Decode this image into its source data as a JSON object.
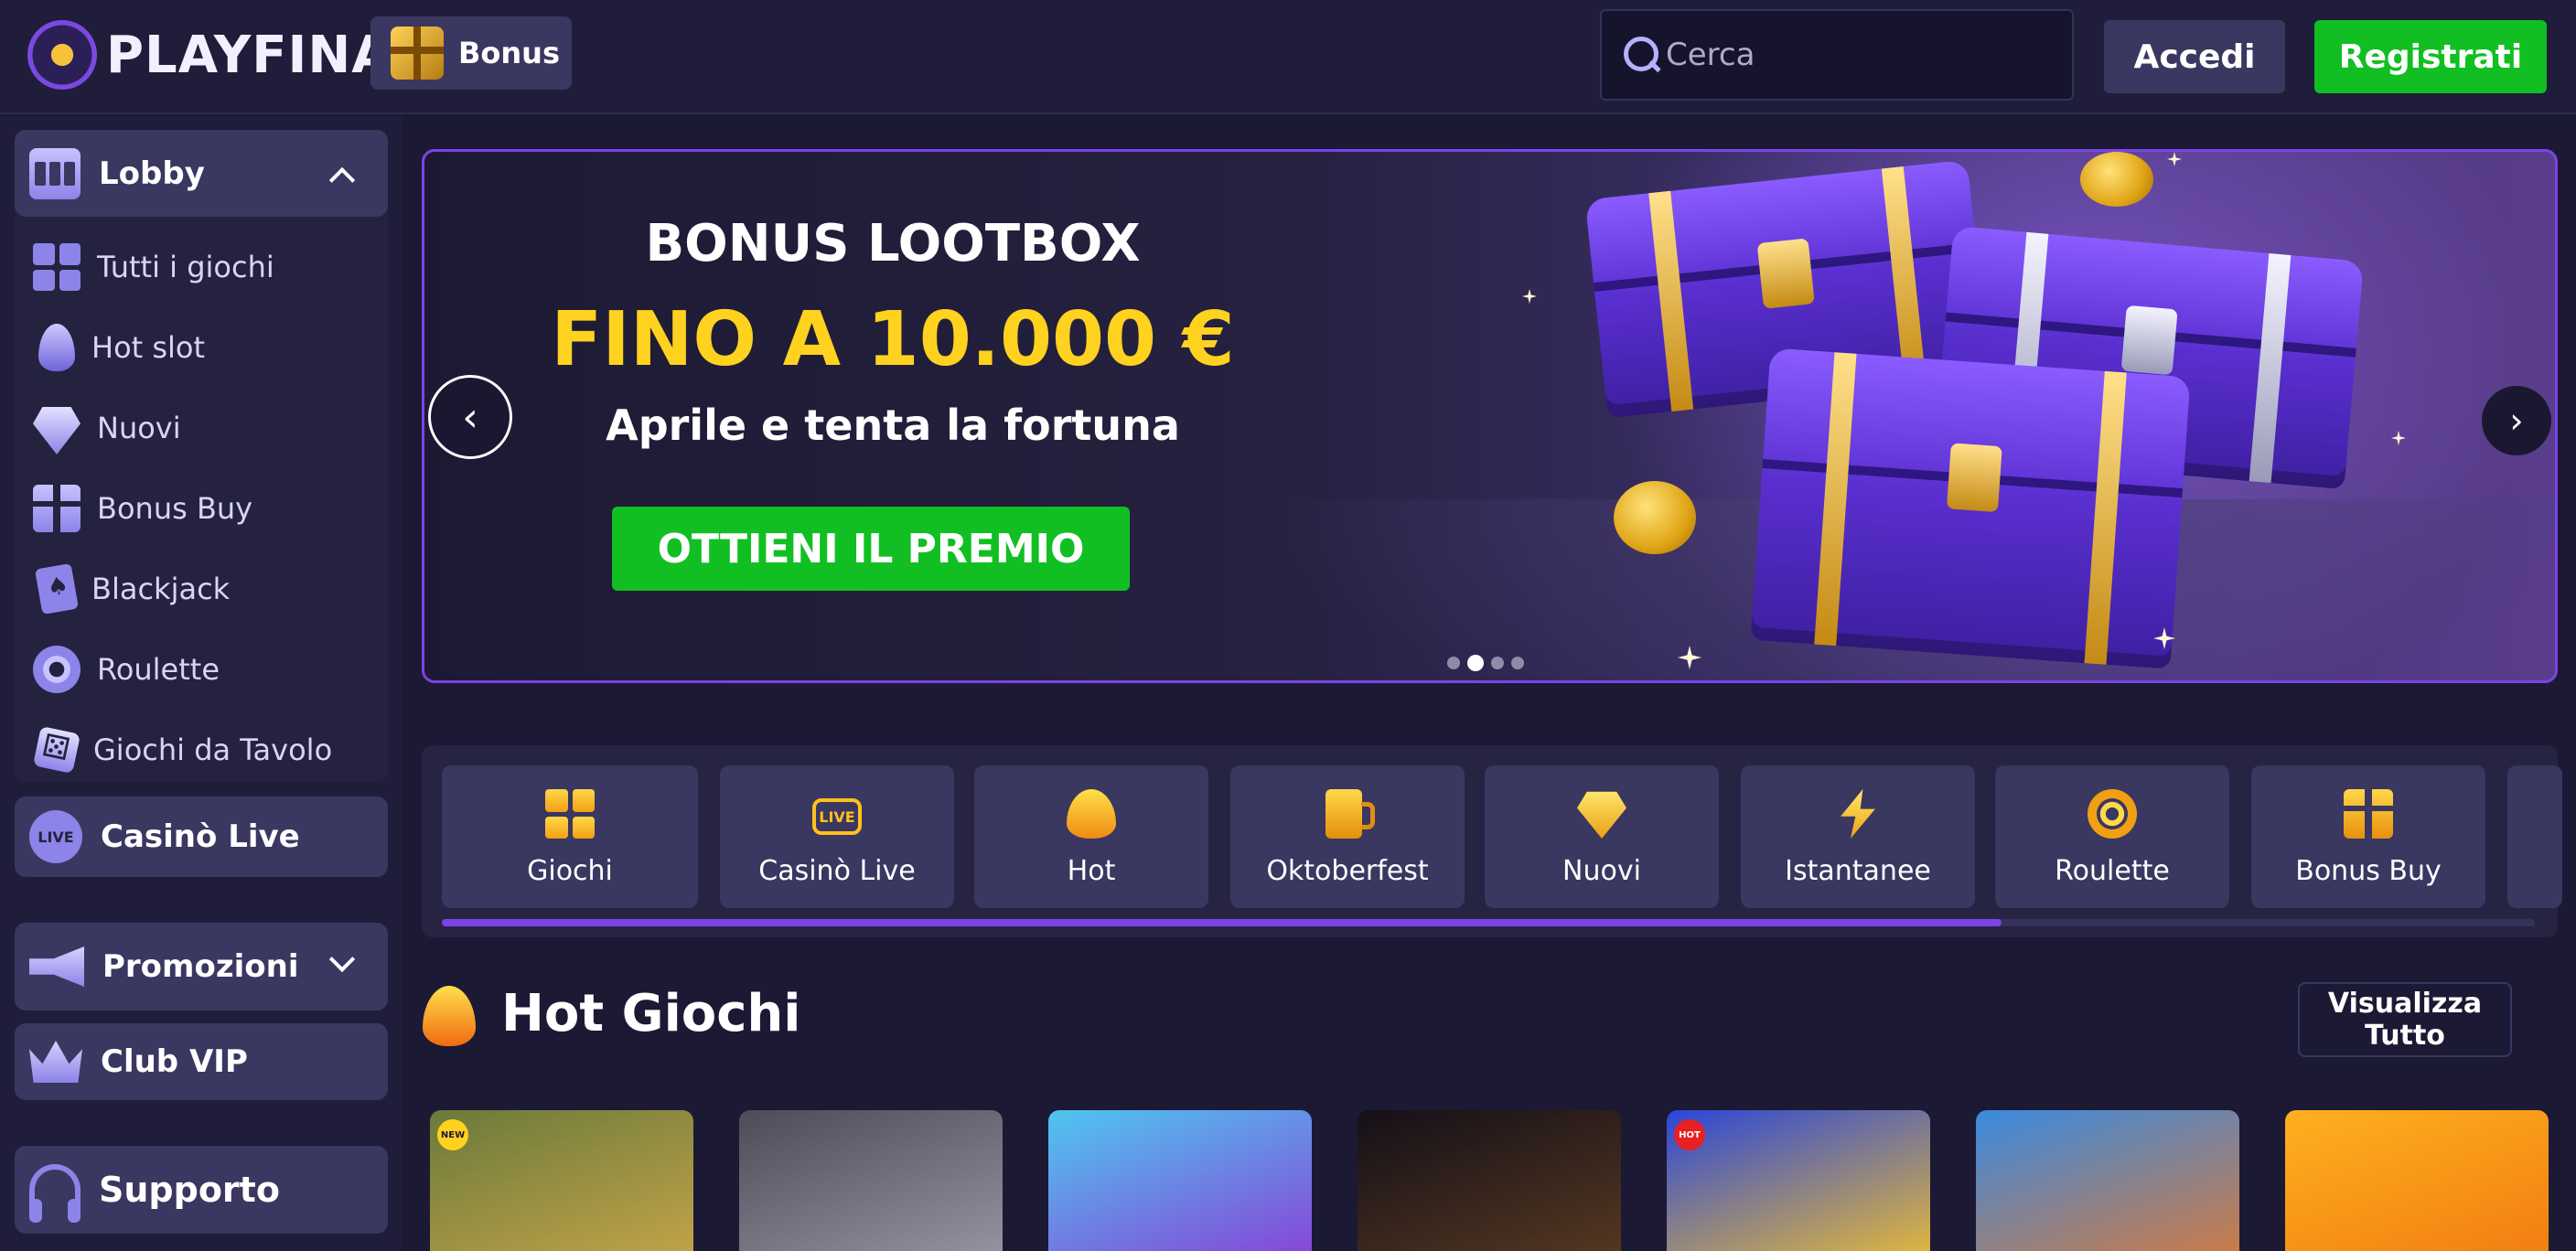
{
  "header": {
    "brand": "PLAYFINA",
    "bonus_label": "Bonus",
    "search_placeholder": "Cerca",
    "login_label": "Accedi",
    "register_label": "Registrati"
  },
  "sidebar": {
    "lobby_label": "Lobby",
    "lobby_items": [
      {
        "label": "Tutti i giochi",
        "icon": "grid-icon"
      },
      {
        "label": "Hot slot",
        "icon": "flame-icon"
      },
      {
        "label": "Nuovi",
        "icon": "diamond-icon"
      },
      {
        "label": "Bonus Buy",
        "icon": "gift-icon"
      },
      {
        "label": "Blackjack",
        "icon": "cards-icon"
      },
      {
        "label": "Roulette",
        "icon": "roulette-icon"
      },
      {
        "label": "Giochi da Tavolo",
        "icon": "dice-icon"
      }
    ],
    "live_label": "Casinò Live",
    "live_badge": "LIVE",
    "promotions_label": "Promozioni",
    "vip_label": "Club VIP",
    "support_label": "Supporto"
  },
  "banner": {
    "title": "BONUS LOOTBOX",
    "amount": "FINO A 10.000 €",
    "subtitle": "Aprile e tenta la fortuna",
    "cta": "OTTIENI IL PREMIO",
    "prev_arrow": "‹",
    "next_arrow": "›",
    "slides_total": 4,
    "active_slide": 2
  },
  "categories": {
    "items": [
      {
        "label": "Giochi",
        "icon": "grid-icon"
      },
      {
        "label": "Casinò Live",
        "icon": "live-icon",
        "badge": "LIVE"
      },
      {
        "label": "Hot",
        "icon": "flame-icon"
      },
      {
        "label": "Oktoberfest",
        "icon": "beer-icon"
      },
      {
        "label": "Nuovi",
        "icon": "diamond-icon"
      },
      {
        "label": "Istantanee",
        "icon": "bolt-icon"
      },
      {
        "label": "Roulette",
        "icon": "roulette-icon"
      },
      {
        "label": "Bonus Buy",
        "icon": "gift-icon"
      }
    ],
    "scroll_progress": 0.745
  },
  "hot_games": {
    "title": "Hot Giochi",
    "view_all": "Visualizza Tutto",
    "games": [
      {
        "tag": "NEW",
        "colors": [
          "#6b7a3a",
          "#c8a64a"
        ]
      },
      {
        "tag": "",
        "colors": [
          "#4c4c58",
          "#9a9aa6"
        ]
      },
      {
        "tag": "",
        "colors": [
          "#4fc6f0",
          "#8b3bd6"
        ]
      },
      {
        "tag": "",
        "colors": [
          "#141018",
          "#5a3a22"
        ]
      },
      {
        "tag": "HOT",
        "colors": [
          "#2b46d8",
          "#f0c030"
        ]
      },
      {
        "tag": "",
        "colors": [
          "#3a8ae0",
          "#d87a3a"
        ]
      },
      {
        "tag": "",
        "colors": [
          "#ffb020",
          "#f07a10"
        ]
      }
    ]
  },
  "colors": {
    "background": "#1b1934",
    "accent_purple": "#7b44e8",
    "cta_green": "#12bf23",
    "gold": "#ffd21f"
  }
}
